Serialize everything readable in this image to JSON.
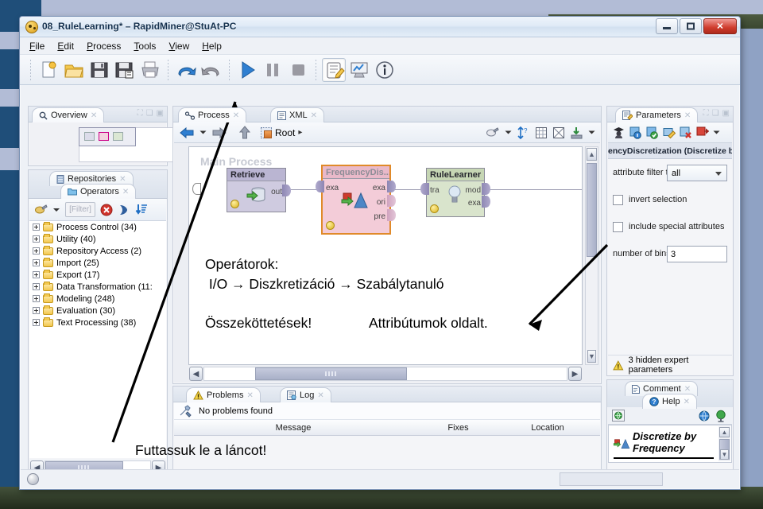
{
  "window": {
    "title": "08_RuleLearning* – RapidMiner@StuAt-PC",
    "app_icon": "rapidminer-icon",
    "controls": {
      "minimize": "minimize-button",
      "restore": "restore-button",
      "close": "✕"
    }
  },
  "menu": {
    "items": [
      "File",
      "Edit",
      "Process",
      "Tools",
      "View",
      "Help"
    ]
  },
  "toolbar": {
    "items": [
      {
        "name": "new-process-icon",
        "selected": false
      },
      {
        "name": "open-process-icon",
        "selected": false
      },
      {
        "name": "save-icon",
        "selected": false
      },
      {
        "name": "save-as-icon",
        "selected": false
      },
      {
        "name": "print-icon",
        "selected": false
      },
      {
        "name": "undo-icon",
        "selected": false
      },
      {
        "name": "redo-icon",
        "selected": false
      },
      {
        "name": "run-process-icon",
        "selected": false
      },
      {
        "name": "pause-process-icon",
        "selected": false
      },
      {
        "name": "stop-process-icon",
        "selected": false
      },
      {
        "name": "design-view-icon",
        "selected": true
      },
      {
        "name": "results-view-icon",
        "selected": false
      },
      {
        "name": "info-icon",
        "selected": false
      }
    ]
  },
  "overview": {
    "tab_label": "Overview",
    "icon": "magnifier-icon"
  },
  "operators_panel": {
    "tabs": [
      {
        "label": "Repositories",
        "icon": "repository-icon",
        "active": false
      },
      {
        "label": "Operators",
        "icon": "operators-folder-icon",
        "active": true
      }
    ],
    "filter_placeholder": "[Filter]",
    "toolbar_icons": [
      "view-mode-icon",
      "dropdown-caret-icon",
      "clear-filter-icon",
      "search-icon",
      "sort-icon"
    ],
    "tree": [
      "Process Control (34)",
      "Utility (40)",
      "Repository Access (2)",
      "Import (25)",
      "Export (17)",
      "Data Transformation (11:",
      "Modeling (248)",
      "Evaluation (30)",
      "Text Processing (38)"
    ]
  },
  "process_panel": {
    "tabs": [
      {
        "label": "Process",
        "icon": "process-icon",
        "active": true
      },
      {
        "label": "XML",
        "icon": "xml-icon",
        "active": false
      }
    ],
    "breadcrumb": "Root",
    "canvas_watermark": "Main Process",
    "input_port": "inp",
    "nav_icons": [
      "back-arrow-icon",
      "forward-arrow-icon",
      "parent-up-icon"
    ],
    "right_icons": [
      "layout-icon",
      "auto-arrange-icon",
      "grid-icon",
      "fit-icon",
      "export-icon"
    ],
    "operators": [
      {
        "name": "Retrieve",
        "icon": "retrieve-database-icon",
        "inputs": [],
        "outputs": [
          "out"
        ],
        "selected": false,
        "color": "#cfcbe0"
      },
      {
        "name": "FrequencyDis...",
        "icon": "discretize-icon",
        "inputs": [
          "exa"
        ],
        "outputs": [
          "exa",
          "ori",
          "pre"
        ],
        "selected": true,
        "color": "#f3ccd8"
      },
      {
        "name": "RuleLearner",
        "icon": "lightbulb-icon",
        "inputs": [
          "tra"
        ],
        "outputs": [
          "mod",
          "exa"
        ],
        "selected": false,
        "color": "#d9e4cc"
      }
    ]
  },
  "problems_panel": {
    "tabs": [
      {
        "label": "Problems",
        "icon": "warning-triangle-icon",
        "active": true
      },
      {
        "label": "Log",
        "icon": "log-icon",
        "active": false
      }
    ],
    "status_text": "No problems found",
    "status_icon": "wrench-icon",
    "columns": [
      "Message",
      "Fixes",
      "Location"
    ]
  },
  "parameters_panel": {
    "tab_label": "Parameters",
    "tab_icon": "parameters-icon",
    "toolbar_icons": [
      "expert-mode-icon",
      "info-param-icon",
      "show-params-icon",
      "edit-param-icon",
      "delete-param-icon",
      "export-param-icon",
      "dropdown-caret-icon"
    ],
    "operator_header": "encyDiscretization (Discretize by Fr",
    "fields": [
      {
        "type": "select",
        "label": "attribute filter ty...",
        "value": "all"
      },
      {
        "type": "checkbox",
        "label": "invert selection",
        "checked": false
      },
      {
        "type": "checkbox",
        "label": "include special attributes",
        "checked": false
      },
      {
        "type": "text",
        "label": "number of bins",
        "value": "3"
      }
    ],
    "hidden_note": "3 hidden expert parameters",
    "hidden_note_icon": "warning-triangle-icon"
  },
  "help_panel": {
    "tabs": [
      {
        "label": "Comment",
        "icon": "comment-document-icon",
        "active": false
      },
      {
        "label": "Help",
        "icon": "help-question-icon",
        "active": true
      }
    ],
    "toolbar_icons": [
      "home-help-icon",
      "wiki-icon",
      "globe-icon"
    ],
    "entry_title_line1": "Discretize by",
    "entry_title_line2": "Frequency",
    "entry_icon": "discretize-icon"
  },
  "annotations": [
    {
      "name": "operators-annotation-line1",
      "text": "Operátorok:"
    },
    {
      "name": "operators-annotation-line2",
      "text": " I/O → Diszkretizáció → Szabálytanuló"
    },
    {
      "name": "connections-annotation",
      "text": "Összeköttetések!"
    },
    {
      "name": "attributes-annotation",
      "text": "Attribútumok oldalt."
    },
    {
      "name": "run-chain-annotation",
      "text": "Futtassuk le a láncot!"
    }
  ],
  "colors": {
    "accent_blue": "#1f6fc4",
    "selection_orange": "#e08a2a",
    "close_red": "#cf3b2c",
    "retrieve_purple": "#cfcbe0",
    "discretize_pink": "#f3ccd8",
    "rulelearner_green": "#d9e4cc"
  }
}
